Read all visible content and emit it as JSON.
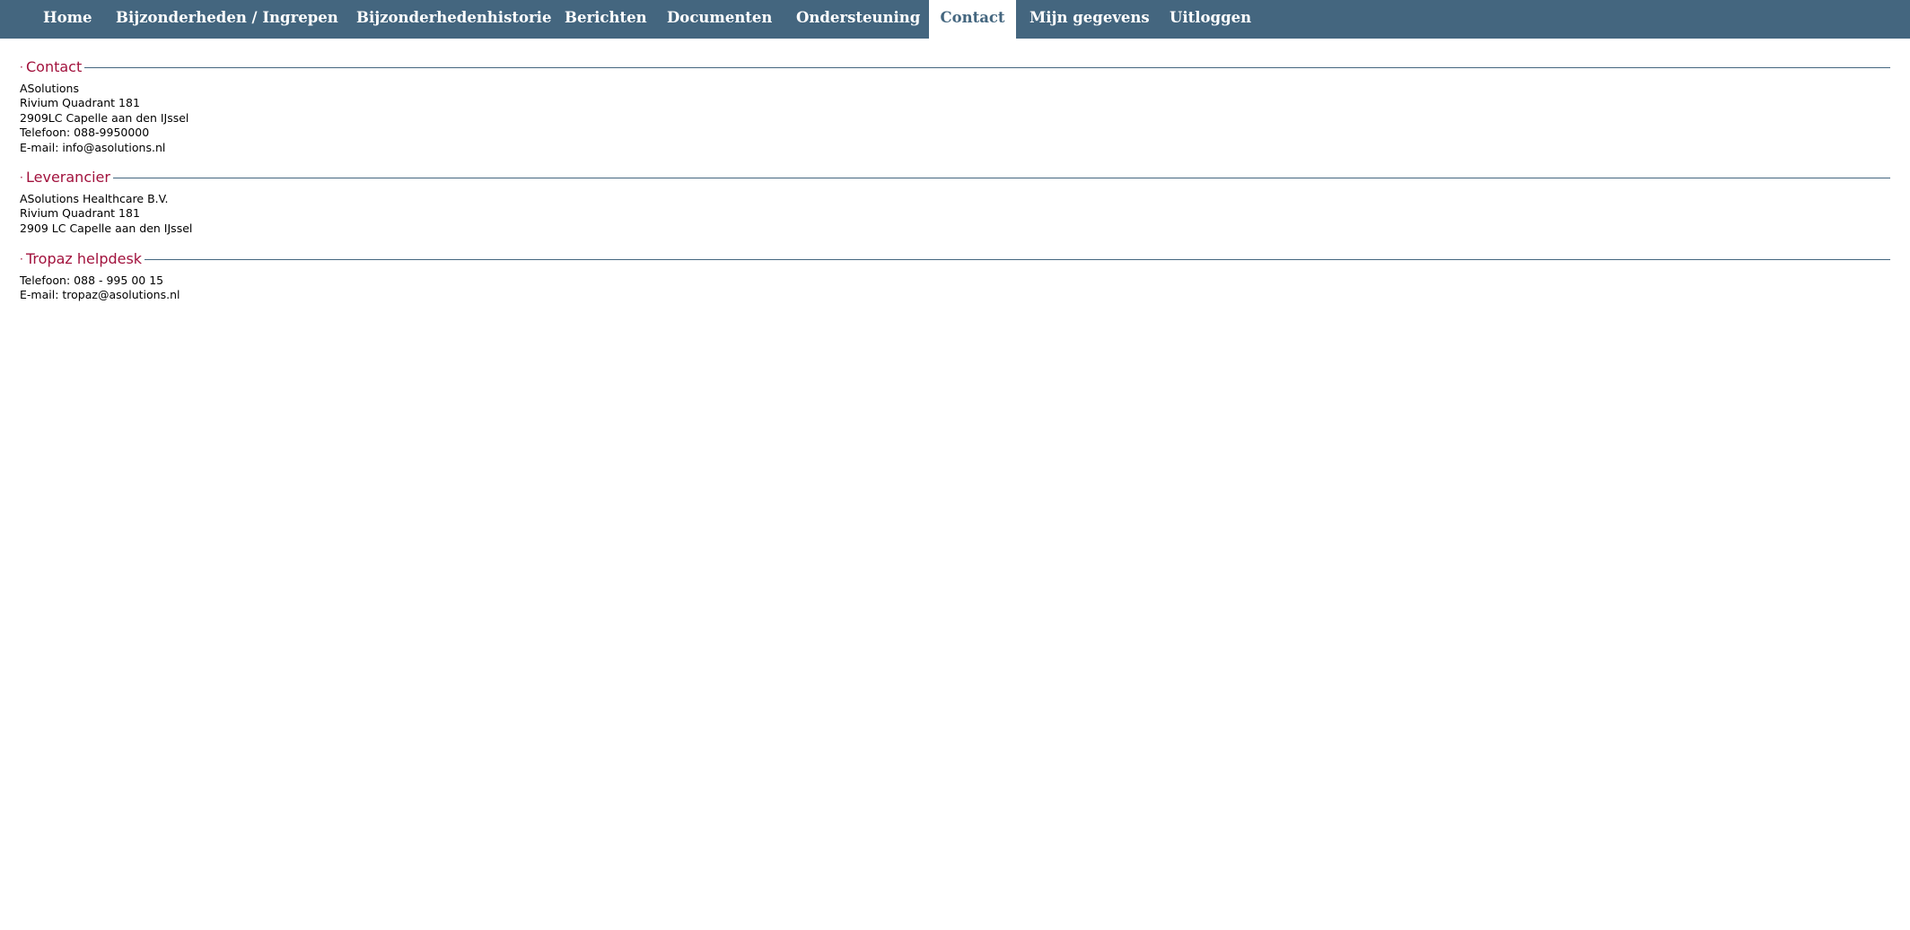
{
  "nav": {
    "items": [
      {
        "label": "Home"
      },
      {
        "label": "Bijzonderheden / Ingrepen"
      },
      {
        "label": "Bijzonderhedenhistorie"
      },
      {
        "label": "Berichten"
      },
      {
        "label": "Documenten"
      },
      {
        "label": "Ondersteuning"
      },
      {
        "label": "Contact",
        "active": true
      },
      {
        "label": "Mijn gegevens"
      },
      {
        "label": "Uitloggen"
      }
    ]
  },
  "sections": [
    {
      "dot": "·",
      "title": "Contact",
      "lines": [
        "ASolutions",
        "Rivium Quadrant 181",
        "2909LC Capelle aan den IJssel",
        "Telefoon: 088-9950000",
        "E-mail: info@asolutions.nl"
      ]
    },
    {
      "dot": "·",
      "title": "Leverancier",
      "lines": [
        "ASolutions Healthcare B.V.",
        "Rivium Quadrant 181",
        "2909 LC Capelle aan den IJssel"
      ]
    },
    {
      "dot": "·",
      "title": "Tropaz helpdesk",
      "lines": [
        "Telefoon: 088 - 995 00 15",
        "E-mail: tropaz@asolutions.nl"
      ]
    }
  ],
  "colors": {
    "nav_background": "#44667f",
    "heading_accent": "#a2123d",
    "divider": "#44667f"
  }
}
